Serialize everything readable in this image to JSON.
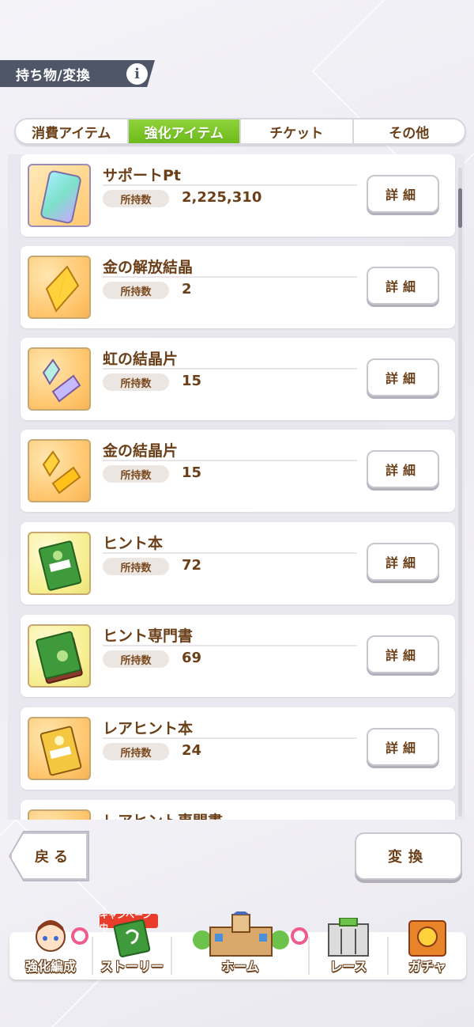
{
  "header": {
    "title": "持ち物/変換",
    "info_label": "i"
  },
  "tabs": [
    {
      "label": "消費アイテム",
      "active": false
    },
    {
      "label": "強化アイテム",
      "active": true
    },
    {
      "label": "チケット",
      "active": false
    },
    {
      "label": "その他",
      "active": false
    }
  ],
  "owned_label": "所持数",
  "detail_label": "詳細",
  "items": [
    {
      "name": "サポートPt",
      "owned": "2,225,310",
      "icon": "support-pt-card-icon"
    },
    {
      "name": "金の解放結晶",
      "owned": "2",
      "icon": "gold-crystal-icon"
    },
    {
      "name": "虹の結晶片",
      "owned": "15",
      "icon": "rainbow-crystal-shard-icon"
    },
    {
      "name": "金の結晶片",
      "owned": "15",
      "icon": "gold-crystal-shard-icon"
    },
    {
      "name": "ヒント本",
      "owned": "72",
      "icon": "hint-book-icon"
    },
    {
      "name": "ヒント専門書",
      "owned": "69",
      "icon": "hint-specialist-book-icon"
    },
    {
      "name": "レアヒント本",
      "owned": "24",
      "icon": "rare-hint-book-icon"
    },
    {
      "name": "レアヒント専門書",
      "icon": "rare-hint-specialist-book-icon"
    }
  ],
  "buttons": {
    "back": "戻る",
    "convert": "変換"
  },
  "nav": {
    "campaign_badge": "キャンペーン中",
    "items": [
      {
        "label": "強化編成"
      },
      {
        "label": "ストーリー"
      },
      {
        "label": "ホーム"
      },
      {
        "label": "レース"
      },
      {
        "label": "ガチャ"
      }
    ]
  },
  "colors": {
    "accent_green": "#7bc42a",
    "text_brown": "#6b3f18",
    "header_gray": "#4e5668",
    "badge_red": "#e83d2b"
  }
}
